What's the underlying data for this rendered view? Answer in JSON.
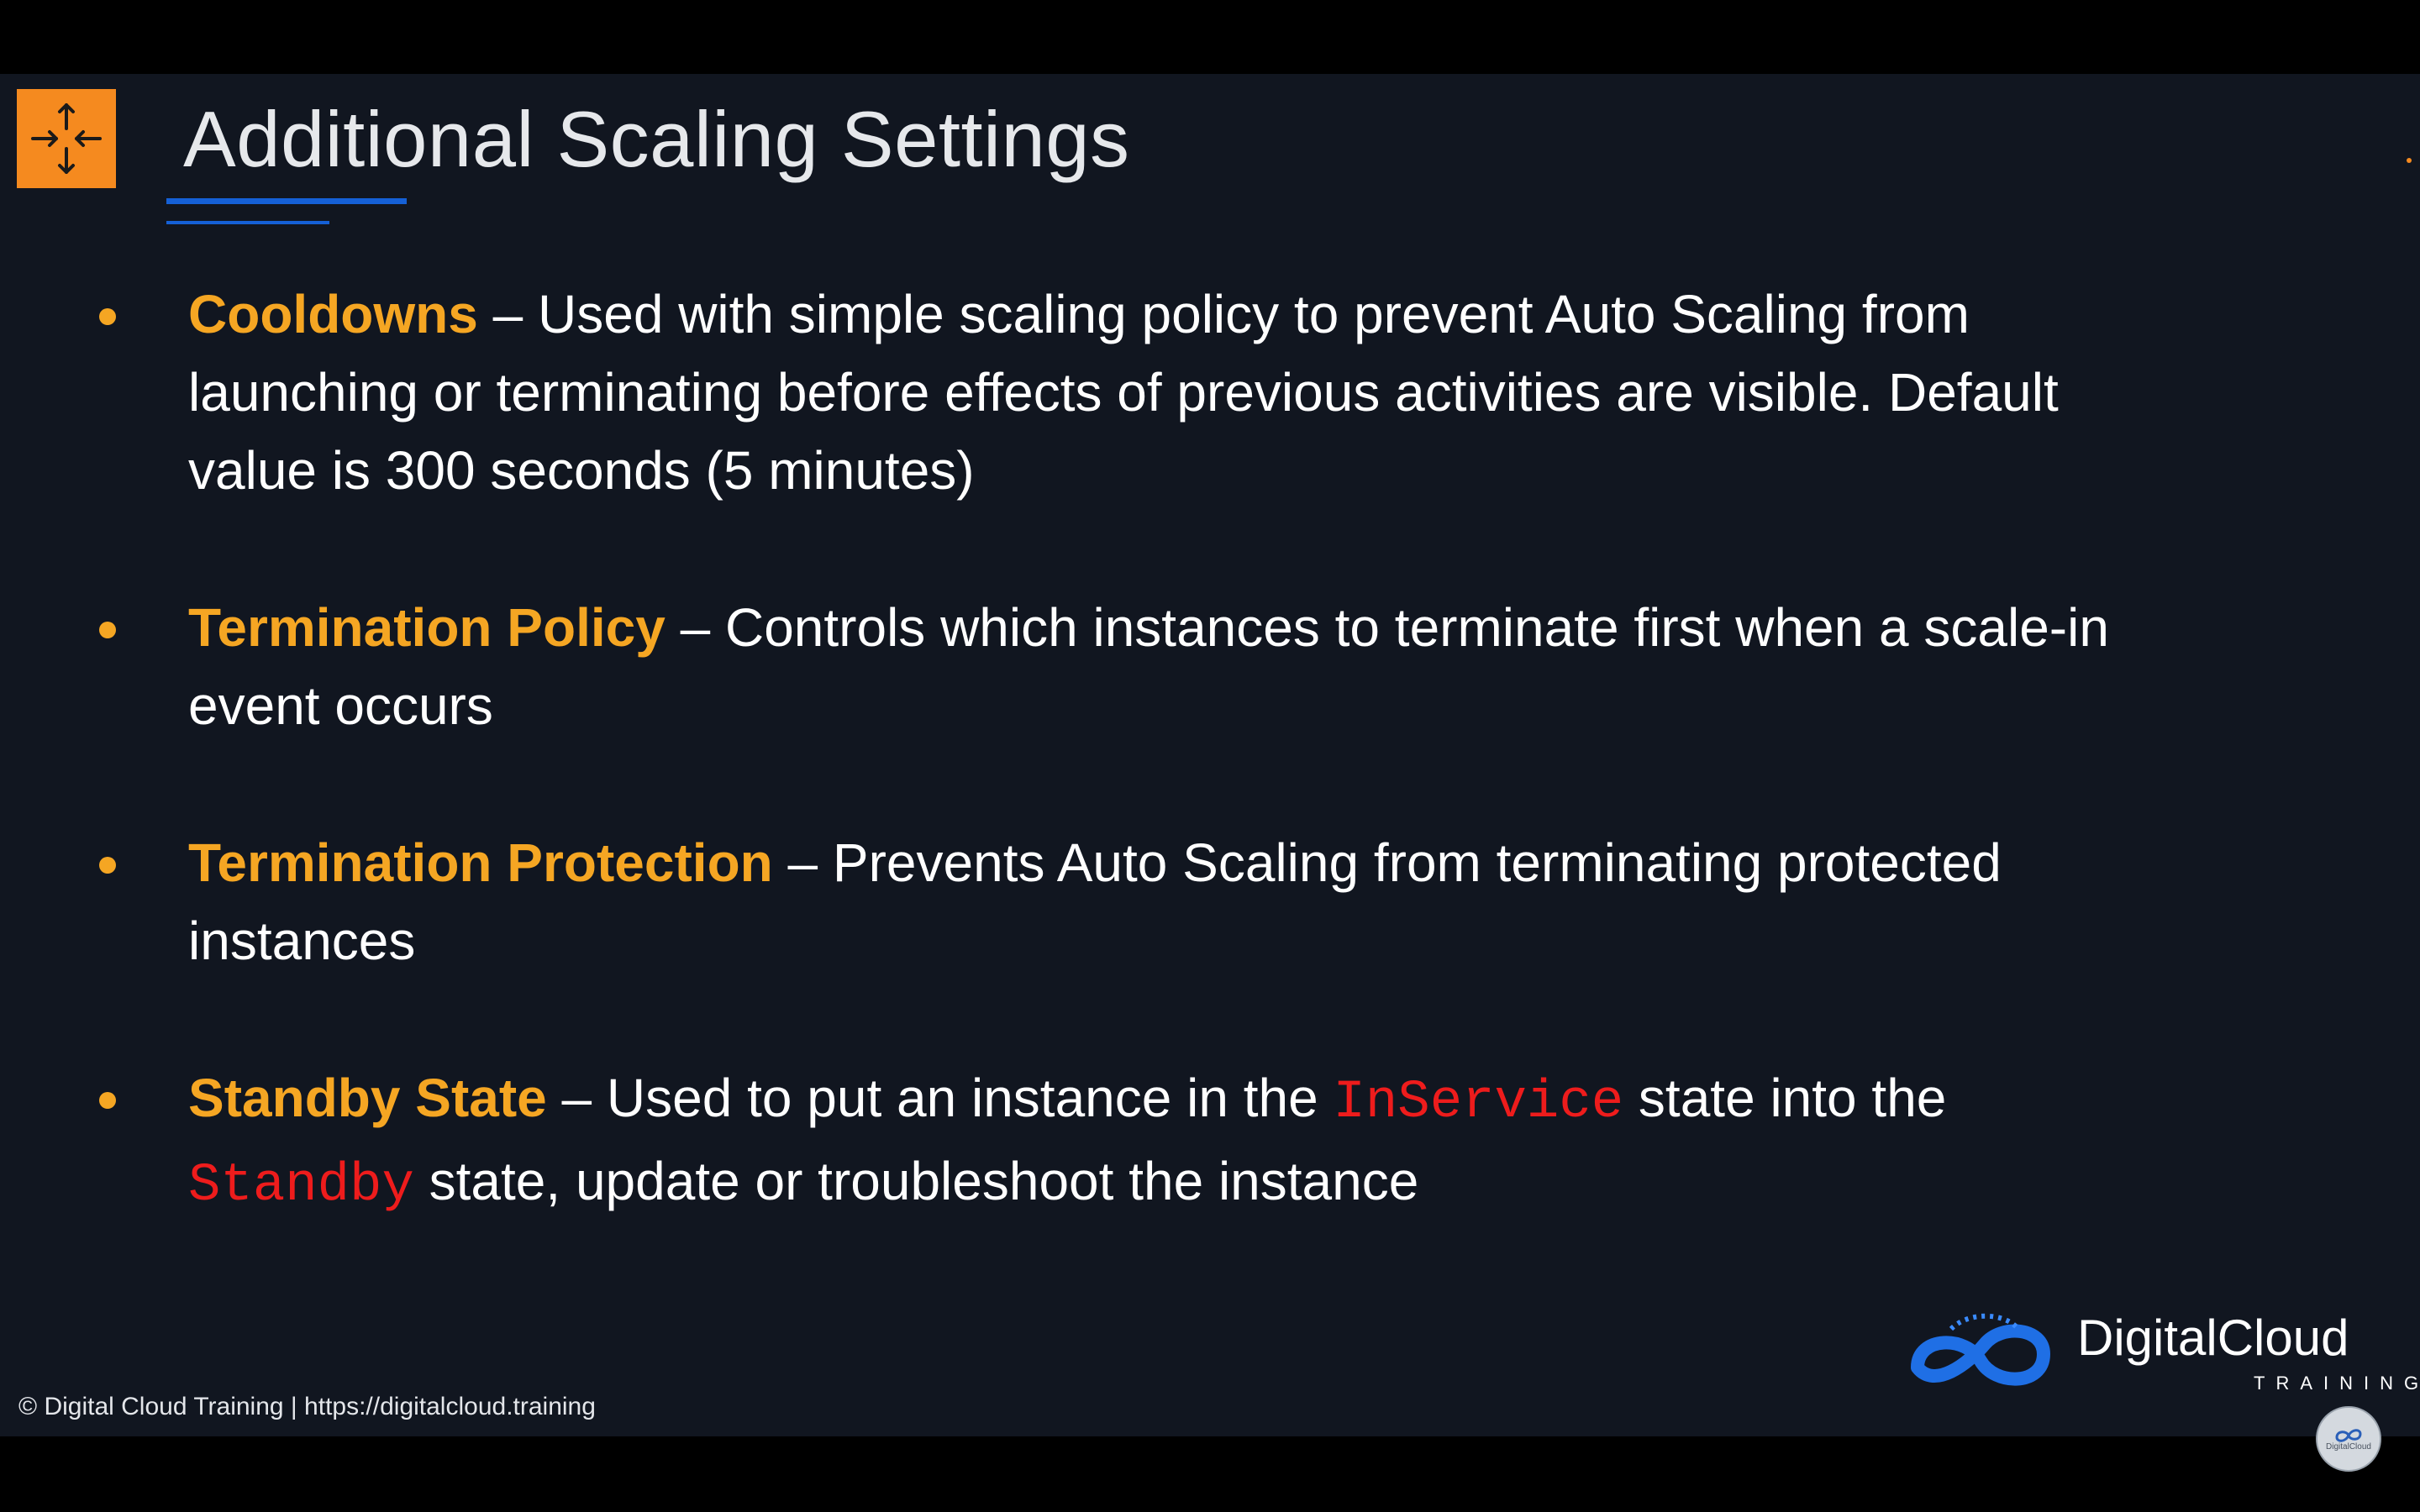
{
  "slide": {
    "title": "Additional Scaling Settings",
    "icon": "auto-scaling-arrows-icon",
    "accent_color": "#f58a1f",
    "rule_color": "#1560d6",
    "bullets": [
      {
        "term": "Cooldowns",
        "text": " – Used with simple scaling policy to prevent Auto Scaling from launching or terminating before effects of previous activities are visible. Default value is 300 seconds (5 minutes)"
      },
      {
        "term": "Termination Policy",
        "text": " – Controls which instances to terminate first when a scale-in event occurs"
      },
      {
        "term": "Termination Protection",
        "text": " – Prevents Auto Scaling from terminating protected instances"
      },
      {
        "term": "Standby State",
        "text_a": " – Used to put an instance in the ",
        "code_a": "InService",
        "text_b": " state into the ",
        "code_b": "Standby",
        "text_c": " state, update or troubleshoot the instance"
      }
    ]
  },
  "brand": {
    "name": "DigitalCloud",
    "tagline": "TRAINING"
  },
  "footer": {
    "text": "© Digital Cloud Training  | https://digitalcloud.training"
  },
  "avatar": {
    "label": "DigitalCloud"
  },
  "colors": {
    "background": "#111620",
    "term": "#f5a623",
    "code": "#ee1c1c",
    "text": "#ffffff"
  }
}
